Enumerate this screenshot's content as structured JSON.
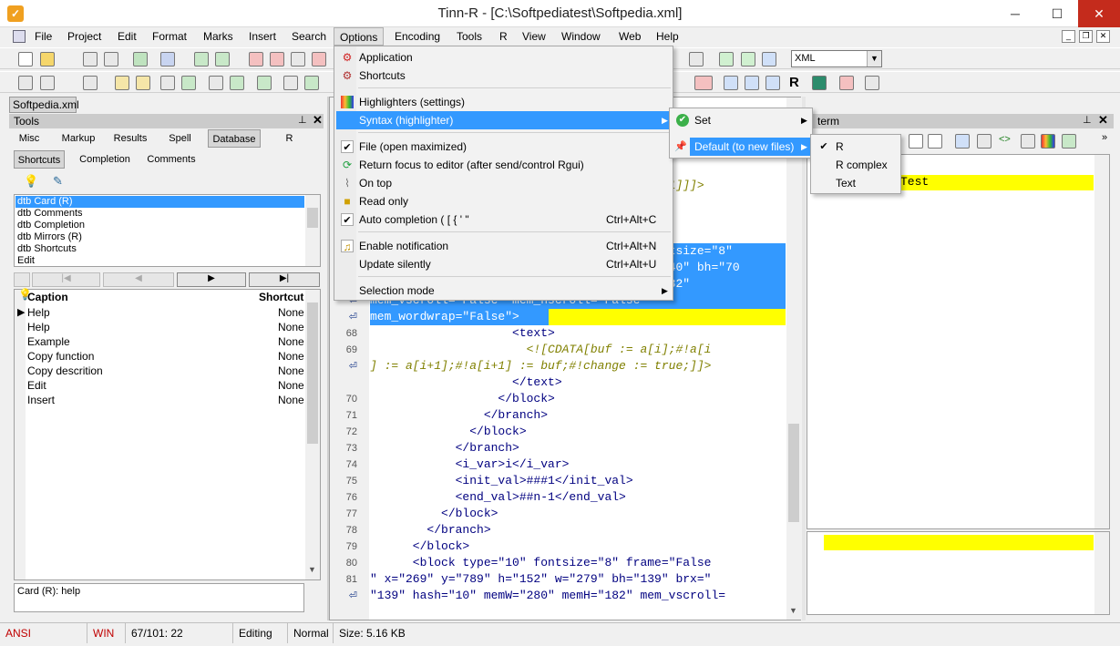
{
  "window": {
    "title": "Tinn-R - [C:\\Softpediatest\\Softpedia.xml]"
  },
  "menubar": [
    "File",
    "Project",
    "Edit",
    "Format",
    "Marks",
    "Insert",
    "Search",
    "Options",
    "Encoding",
    "Tools",
    "R",
    "View",
    "Window",
    "Web",
    "Help"
  ],
  "toolbar": {
    "language_select": "XML"
  },
  "file_tab": "Softpedia.xml",
  "tools": {
    "title": "Tools",
    "tabs": [
      "Misc",
      "Markup",
      "Results",
      "Spell",
      "Database",
      "R"
    ],
    "subtabs": [
      "Shortcuts",
      "Completion",
      "Comments"
    ],
    "list": [
      "dtb Card (R)",
      "dtb Comments",
      "dtb Completion",
      "dtb Mirrors (R)",
      "dtb Shortcuts",
      "Edit"
    ],
    "table_headers": {
      "caption": "Caption",
      "shortcut": "Shortcut"
    },
    "rows": [
      {
        "caption": "Help",
        "shortcut": "None"
      },
      {
        "caption": "Help",
        "shortcut": "None"
      },
      {
        "caption": "Example",
        "shortcut": "None"
      },
      {
        "caption": "Copy function",
        "shortcut": "None"
      },
      {
        "caption": "Copy descrition",
        "shortcut": "None"
      },
      {
        "caption": "Edit",
        "shortcut": "None"
      },
      {
        "caption": "Insert",
        "shortcut": "None"
      }
    ],
    "info": "Card (R): help"
  },
  "editor": {
    "lines": [
      {
        "n": "",
        "text": "                                       [i+1]]]>",
        "cls": "cdata"
      },
      {
        "n": "",
        "text": "",
        "cls": ""
      },
      {
        "n": "",
        "text": "",
        "cls": ""
      },
      {
        "n": "",
        "text": "",
        "cls": ""
      },
      {
        "n": "",
        "text": "                                       fontsize=\"8\"",
        "cls": "hl"
      },
      {
        "n": "",
        "text": "                                       =\"140\" bh=\"70",
        "cls": "hl"
      },
      {
        "n": "",
        "text": "                                       =\"182\"",
        "cls": "hl"
      },
      {
        "n": "wrap",
        "text": "mem_vscroll=\"False\" mem_hscroll=\"False\"",
        "cls": "hl"
      },
      {
        "n": "wrap",
        "text": "mem_wordwrap=\"False\">",
        "cls": "hl"
      },
      {
        "n": "68",
        "text": "                    <text>",
        "cls": "tag"
      },
      {
        "n": "69",
        "text": "                      <![CDATA[buf := a[i];#!a[i",
        "cls": "cdata"
      },
      {
        "n": "wrap",
        "text": "] := a[i+1];#!a[i+1] := buf;#!change := true;]]>",
        "cls": "cdata"
      },
      {
        "n": "",
        "text": "                    </text>",
        "cls": "tag"
      },
      {
        "n": "70",
        "text": "                  </block>",
        "cls": "tag"
      },
      {
        "n": "71",
        "text": "                </branch>",
        "cls": "tag"
      },
      {
        "n": "72",
        "text": "              </block>",
        "cls": "tag"
      },
      {
        "n": "73",
        "text": "            </branch>",
        "cls": "tag"
      },
      {
        "n": "74",
        "text": "            <i_var>i</i_var>",
        "cls": "tag"
      },
      {
        "n": "75",
        "text": "            <init_val>###1</init_val>",
        "cls": "tag"
      },
      {
        "n": "76",
        "text": "            <end_val>##n-1</end_val>",
        "cls": "tag"
      },
      {
        "n": "77",
        "text": "          </block>",
        "cls": "tag"
      },
      {
        "n": "78",
        "text": "        </branch>",
        "cls": "tag"
      },
      {
        "n": "79",
        "text": "      </block>",
        "cls": "tag"
      },
      {
        "n": "80",
        "text": "      <block type=\"10\" fontsize=\"8\" frame=\"False",
        "cls": "tag"
      },
      {
        "n": "81",
        "text": "\" x=\"269\" y=\"789\" h=\"152\" w=\"279\" bh=\"139\" brx=\"",
        "cls": "tag"
      },
      {
        "n": "wrap",
        "text": "\"139\" hash=\"10\" memW=\"280\" memH=\"182\" mem_vscroll=",
        "cls": "tag"
      }
    ]
  },
  "rterm": {
    "title": "term",
    "yellow_text": "Test"
  },
  "options_menu": {
    "items": [
      {
        "label": "Application",
        "shortcut": "",
        "icon": "gear-icon",
        "sep_after": false
      },
      {
        "label": "Shortcuts",
        "shortcut": "",
        "icon": "keys-icon",
        "sep_after": true
      },
      {
        "label": "Highlighters (settings)",
        "shortcut": "",
        "icon": "palette-icon",
        "sep_after": false
      },
      {
        "label": "Syntax (highlighter)",
        "shortcut": "",
        "icon": "",
        "sep_after": true,
        "submenu": true,
        "highlighted": true
      },
      {
        "label": "File (open maximized)",
        "shortcut": "",
        "icon": "check-icon",
        "sep_after": false
      },
      {
        "label": "Return focus to editor (after send/control Rgui)",
        "shortcut": "",
        "icon": "refresh-icon",
        "sep_after": false
      },
      {
        "label": "On top",
        "shortcut": "",
        "icon": "paperclip-icon",
        "sep_after": false
      },
      {
        "label": "Read only",
        "shortcut": "",
        "icon": "lock-icon",
        "sep_after": false
      },
      {
        "label": "Auto completion ( [ { ' \"",
        "shortcut": "Ctrl+Alt+C",
        "icon": "check-icon",
        "sep_after": true
      },
      {
        "label": "Enable notification",
        "shortcut": "Ctrl+Alt+N",
        "icon": "bell-icon",
        "sep_after": false
      },
      {
        "label": "Update silently",
        "shortcut": "Ctrl+Alt+U",
        "icon": "",
        "sep_after": true
      },
      {
        "label": "Selection mode",
        "shortcut": "",
        "icon": "",
        "sep_after": false,
        "submenu": true
      }
    ]
  },
  "syntax_submenu": {
    "items": [
      "Set",
      "Default (to new files)"
    ]
  },
  "default_submenu": {
    "items": [
      "R",
      "R complex",
      "Text"
    ]
  },
  "statusbar": [
    "ANSI",
    "WIN",
    "67/101: 22",
    "Editing",
    "Normal",
    "Size: 5.16 KB"
  ],
  "colors": {
    "highlight": "#3399ff",
    "yellow": "#ffff00",
    "status_red": "#c00000"
  }
}
